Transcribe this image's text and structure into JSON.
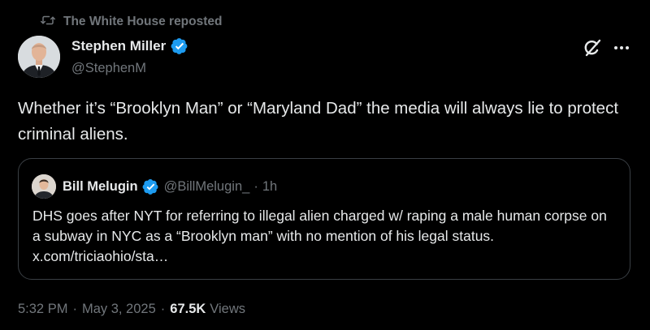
{
  "repost": {
    "label": "The White House reposted",
    "icon": "repost-icon"
  },
  "author": {
    "name": "Stephen Miller",
    "handle": "@StephenM",
    "verified_icon": "verified-badge-icon",
    "verified_color": "#1d9bf0"
  },
  "actions": {
    "grok_icon": "grok-icon",
    "more_icon": "more-options-icon"
  },
  "tweet": {
    "text": "Whether it’s “Brooklyn Man” or “Maryland Dad” the media will always lie to protect criminal aliens."
  },
  "quote": {
    "name": "Bill Melugin",
    "handle": "@BillMelugin_",
    "separator": "·",
    "time": "1h",
    "text": "DHS goes after NYT for referring to illegal alien charged w/ raping a male human corpse on a subway in NYC as a “Brooklyn man” with no mention of his legal status. x.com/triciaohio/sta…"
  },
  "meta": {
    "time": "5:32 PM",
    "separator": "·",
    "date": "May 3, 2025",
    "views_count": "67.5K",
    "views_label": "Views"
  },
  "colors": {
    "background": "#000000",
    "primary_text": "#e7e9ea",
    "secondary_text": "#71767b",
    "card_border": "#3a3f44"
  }
}
